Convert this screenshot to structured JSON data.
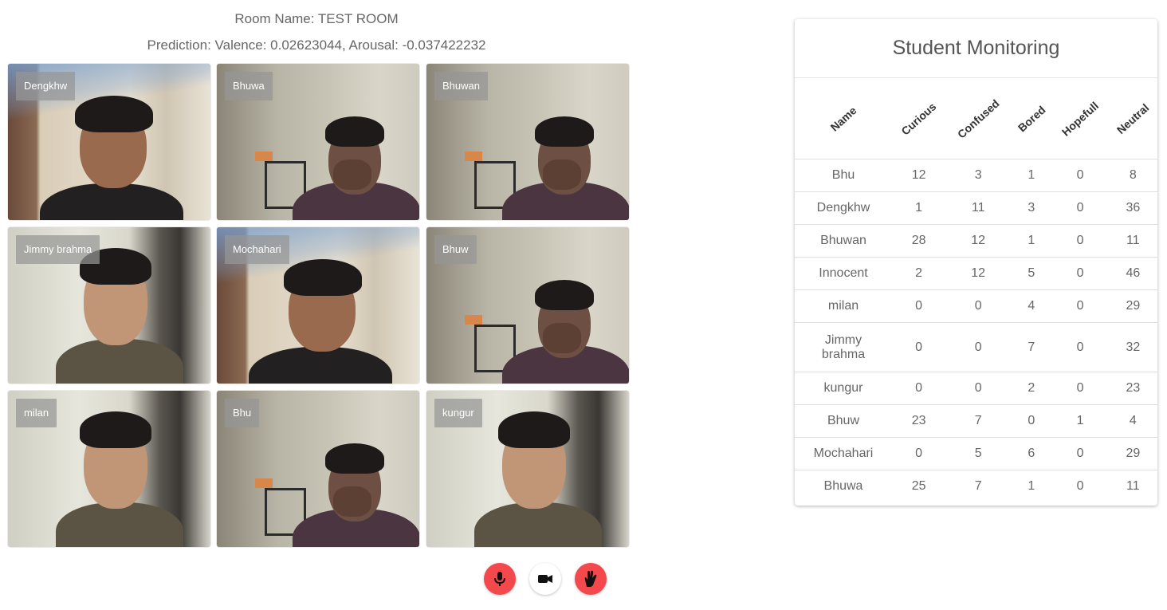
{
  "room_name": "Room Name: TEST ROOM",
  "prediction": "Prediction: Valence: 0.02623044, Arousal: -0.037422232",
  "tiles": [
    {
      "name": "Dengkhw",
      "scene": "A"
    },
    {
      "name": "Bhuwa",
      "scene": "B"
    },
    {
      "name": "Bhuwan",
      "scene": "B"
    },
    {
      "name": "Jimmy brahma",
      "scene": "C"
    },
    {
      "name": "Mochahari",
      "scene": "A"
    },
    {
      "name": "Bhuw",
      "scene": "B"
    },
    {
      "name": "milan",
      "scene": "C"
    },
    {
      "name": "Bhu",
      "scene": "B"
    },
    {
      "name": "kungur",
      "scene": "C"
    }
  ],
  "controls": [
    {
      "icon": "microphone-icon",
      "color": "#f4494c"
    },
    {
      "icon": "video-camera-icon",
      "color": "#ffffff"
    },
    {
      "icon": "raise-hand-icon",
      "color": "#f4494c"
    }
  ],
  "monitoring": {
    "title": "Student Monitoring",
    "columns": [
      "Name",
      "Curious",
      "Confused",
      "Bored",
      "Hopefull",
      "Neutral"
    ],
    "rows": [
      [
        "Bhu",
        "12",
        "3",
        "1",
        "0",
        "8"
      ],
      [
        "Dengkhw",
        "1",
        "11",
        "3",
        "0",
        "36"
      ],
      [
        "Bhuwan",
        "28",
        "12",
        "1",
        "0",
        "11"
      ],
      [
        "Innocent",
        "2",
        "12",
        "5",
        "0",
        "46"
      ],
      [
        "milan",
        "0",
        "0",
        "4",
        "0",
        "29"
      ],
      [
        "Jimmy brahma",
        "0",
        "0",
        "7",
        "0",
        "32"
      ],
      [
        "kungur",
        "0",
        "0",
        "2",
        "0",
        "23"
      ],
      [
        "Bhuw",
        "23",
        "7",
        "0",
        "1",
        "4"
      ],
      [
        "Mochahari",
        "0",
        "5",
        "6",
        "0",
        "29"
      ],
      [
        "Bhuwa",
        "25",
        "7",
        "1",
        "0",
        "11"
      ]
    ]
  }
}
